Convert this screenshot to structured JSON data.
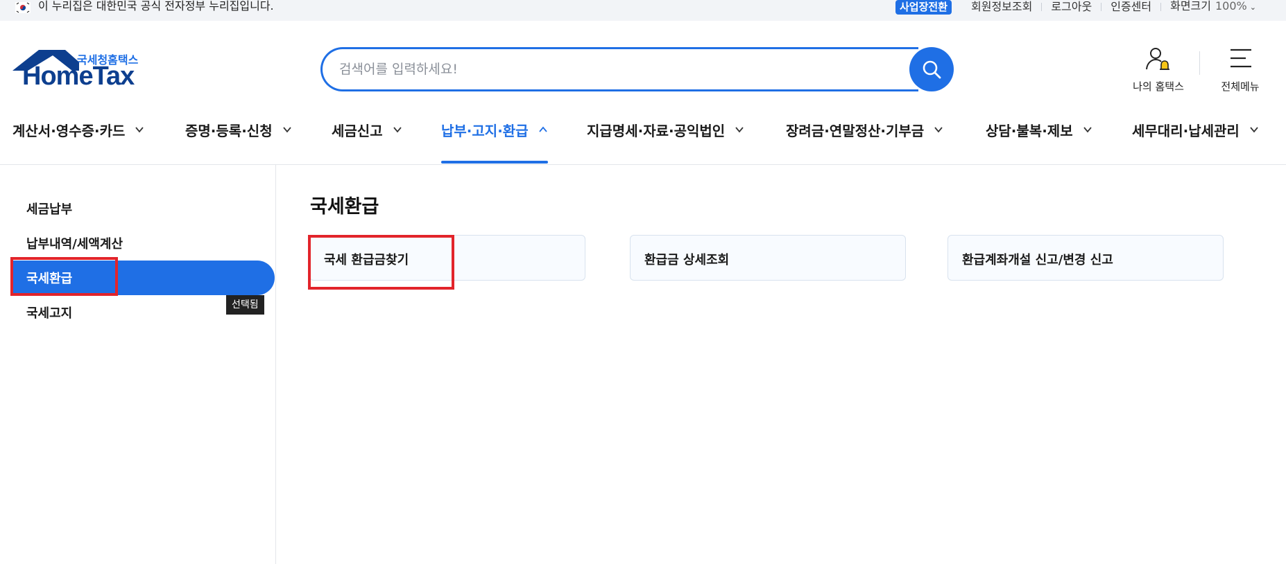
{
  "gov_banner": {
    "text": "이 누리집은 대한민국 공식 전자정부 누리집입니다."
  },
  "utility": {
    "switch_label": "사업장전환",
    "member_info": "회원정보조회",
    "logout": "로그아웃",
    "cert_center": "인증센터",
    "zoom_label": "화면크기",
    "zoom_value": "100%"
  },
  "logo": {
    "kr": "국세청홈택스",
    "en": "HomeTax"
  },
  "search": {
    "placeholder": "검색어를 입력하세요!"
  },
  "header": {
    "my_hometax": "나의 홈택스",
    "all_menu": "전체메뉴"
  },
  "gnb": {
    "items": [
      {
        "label": "계산서·영수증·카드"
      },
      {
        "label": "증명·등록·신청"
      },
      {
        "label": "세금신고"
      },
      {
        "label": "납부·고지·환급",
        "active": true
      },
      {
        "label": "지급명세·자료·공익법인"
      },
      {
        "label": "장려금·연말정산·기부금"
      },
      {
        "label": "상담·불복·제보"
      },
      {
        "label": "세무대리·납세관리"
      }
    ]
  },
  "lnb": {
    "items": [
      {
        "label": "세금납부"
      },
      {
        "label": "납부내역/세액계산"
      },
      {
        "label": "국세환급",
        "active": true
      },
      {
        "label": "국세고지"
      }
    ],
    "tooltip": "선택됨"
  },
  "main": {
    "title": "국세환급",
    "cards": [
      {
        "label": "국세 환급금찾기"
      },
      {
        "label": "환급금 상세조회"
      },
      {
        "label": "환급계좌개설 신고/변경 신고"
      }
    ]
  },
  "colors": {
    "brand_blue": "#1f6fe5",
    "logo_navy": "#0d3f8f",
    "highlight_red": "#e2242b"
  }
}
